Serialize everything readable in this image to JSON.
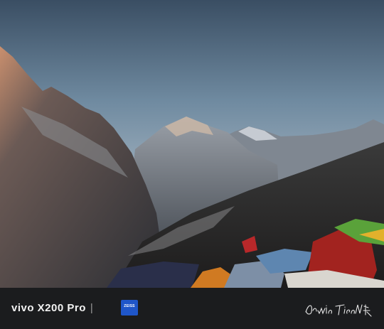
{
  "photo": {
    "subject": "mountain-landscape-with-prayer-flags"
  },
  "watermark": {
    "brand_text": "vivo X200 Pro",
    "separator": "|",
    "zeiss_label": "ZEISS",
    "signature_text": "DawinTienNN 航拍"
  },
  "colors": {
    "bar_background": "#1b1c1e",
    "zeiss_blue": "#1f56c9"
  }
}
